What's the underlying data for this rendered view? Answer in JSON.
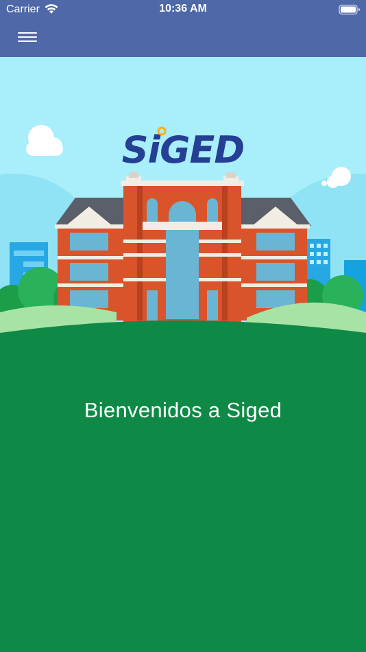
{
  "status_bar": {
    "carrier": "Carrier",
    "time": "10:36 AM",
    "wifi_icon": "wifi-icon",
    "battery_icon": "battery-icon"
  },
  "nav_bar": {
    "menu_icon": "hamburger-menu-icon",
    "background_color": "#4e68a8"
  },
  "hero": {
    "logo_text": "SiGED",
    "sky_color": "#a8eefb",
    "ground_color": "#0e8a46"
  },
  "main": {
    "welcome_text": "Bienvenidos a Siged"
  }
}
